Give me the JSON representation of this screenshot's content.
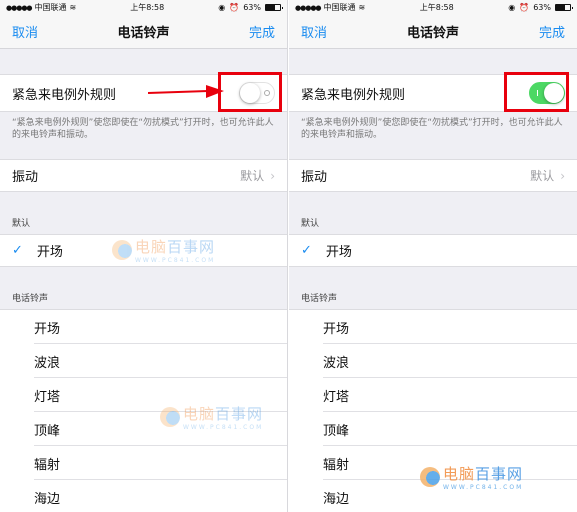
{
  "status_bar": {
    "signal_dots": "●●●●●",
    "carrier": "中国联通",
    "wifi_icon": "wifi-icon",
    "time": "上午8:58",
    "lock_icon": "rotation-lock-icon",
    "alarm_icon": "alarm-icon",
    "battery_percent": "63%",
    "battery_level": 0.63
  },
  "nav": {
    "cancel_label": "取消",
    "title": "电话铃声",
    "done_label": "完成"
  },
  "emergency": {
    "label": "紧急来电例外规则",
    "note": "“紧急来电例外规则”使您即使在“勿扰模式”打开时，也可允许此人的来电铃声和振动。"
  },
  "panels": [
    {
      "emergency_on": false
    },
    {
      "emergency_on": true
    }
  ],
  "vibration": {
    "label": "振动",
    "value": "默认",
    "chevron": "›"
  },
  "default_section": {
    "header": "默认",
    "selected": "开场",
    "check": "✓"
  },
  "ringtone_section": {
    "header": "电话铃声",
    "items": [
      "开场",
      "波浪",
      "灯塔",
      "顶峰",
      "辐射",
      "海边"
    ]
  },
  "watermark": {
    "brand_a": "电脑",
    "brand_b": "百事网",
    "url": "WWW.PC841.COM"
  },
  "colors": {
    "accent": "#1a8cf0",
    "toggle_on": "#4cd864",
    "highlight_red": "#e8000d"
  }
}
